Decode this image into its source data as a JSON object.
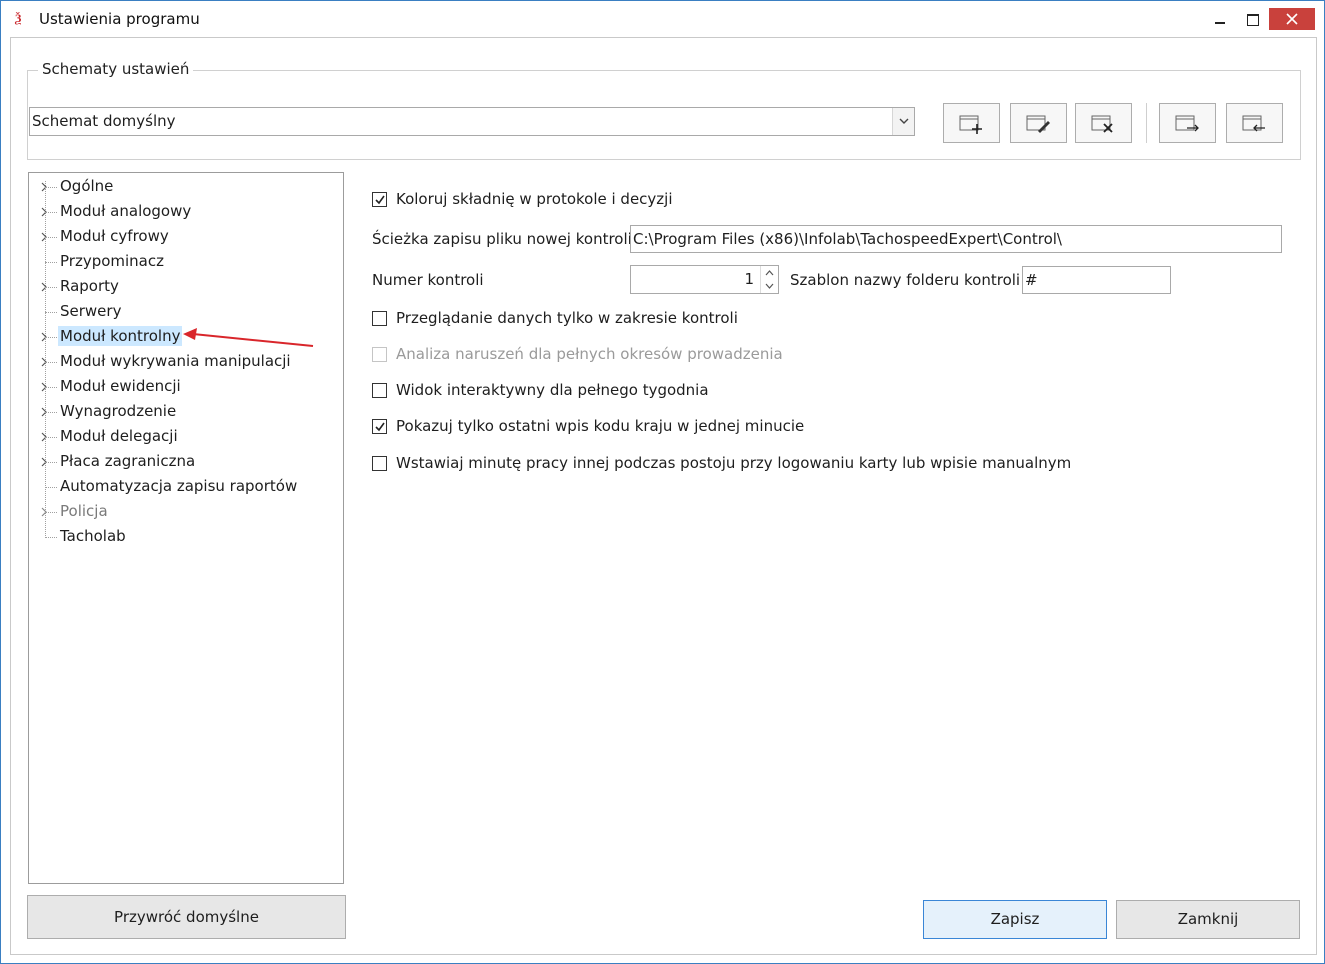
{
  "window": {
    "title": "Ustawienia programu",
    "accent": "#c9413c"
  },
  "schemes": {
    "legend": "Schematy ustawień",
    "selected": "Schemat domyślny",
    "buttons": [
      "add-scheme-icon",
      "edit-scheme-icon",
      "delete-scheme-icon",
      "export-scheme-icon",
      "import-scheme-icon"
    ]
  },
  "tree": {
    "items": [
      {
        "label": "Ogólne",
        "expandable": true
      },
      {
        "label": "Moduł analogowy",
        "expandable": true
      },
      {
        "label": "Moduł cyfrowy",
        "expandable": true
      },
      {
        "label": "Przypominacz",
        "expandable": false
      },
      {
        "label": "Raporty",
        "expandable": true
      },
      {
        "label": "Serwery",
        "expandable": false
      },
      {
        "label": "Moduł kontrolny",
        "expandable": true,
        "selected": true
      },
      {
        "label": "Moduł wykrywania manipulacji",
        "expandable": true
      },
      {
        "label": "Moduł ewidencji",
        "expandable": true
      },
      {
        "label": "Wynagrodzenie",
        "expandable": true
      },
      {
        "label": "Moduł delegacji",
        "expandable": true
      },
      {
        "label": "Płaca zagraniczna",
        "expandable": true
      },
      {
        "label": "Automatyzacja zapisu raportów",
        "expandable": false
      },
      {
        "label": "Policja",
        "expandable": true,
        "disabled": true
      },
      {
        "label": "Tacholab",
        "expandable": false
      }
    ]
  },
  "settings": {
    "color_syntax": {
      "label": "Koloruj składnię w protokole i decyzji",
      "checked": true
    },
    "path_label": "Ścieżka zapisu pliku nowej kontroli",
    "path_value": "C:\\Program Files (x86)\\Infolab\\TachospeedExpert\\Control\\",
    "number_label": "Numer kontroli",
    "number_value": "1",
    "folder_template_label": "Szablon nazwy folderu kontroli",
    "folder_template_value": "#",
    "browse_range": {
      "label": "Przeglądanie danych tylko w zakresie kontroli",
      "checked": false
    },
    "violation_analysis": {
      "label": "Analiza naruszeń dla pełnych okresów prowadzenia",
      "checked": false,
      "disabled": true
    },
    "interactive_view": {
      "label": "Widok interaktywny dla pełnego tygodnia",
      "checked": false
    },
    "last_country": {
      "label": "Pokazuj tylko ostatni wpis kodu kraju w jednej minucie",
      "checked": true
    },
    "insert_minute": {
      "label": "Wstawiaj minutę pracy innej podczas postoju przy logowaniu karty lub wpisie manualnym",
      "checked": false
    }
  },
  "footer": {
    "restore_label": "Przywróć domyślne",
    "save_label": "Zapisz",
    "close_label": "Zamknij"
  },
  "annotation_color": "#d9262b"
}
